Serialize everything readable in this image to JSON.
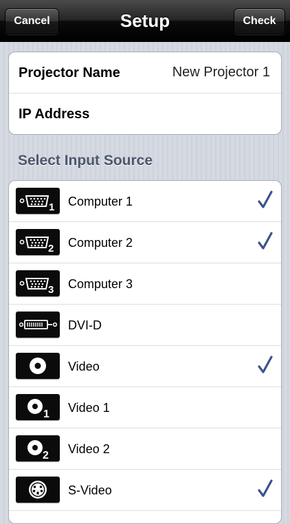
{
  "navbar": {
    "title": "Setup",
    "cancel_label": "Cancel",
    "check_label": "Check"
  },
  "info": {
    "projector_name_label": "Projector Name",
    "projector_name_value": "New Projector 1",
    "ip_address_label": "IP Address",
    "ip_address_value": ""
  },
  "section_header": "Select Input Source",
  "sources": [
    {
      "label": "Computer 1",
      "icon": "vga-1-icon",
      "checked": true
    },
    {
      "label": "Computer 2",
      "icon": "vga-2-icon",
      "checked": true
    },
    {
      "label": "Computer 3",
      "icon": "vga-3-icon",
      "checked": false
    },
    {
      "label": "DVI-D",
      "icon": "dvi-icon",
      "checked": false
    },
    {
      "label": "Video",
      "icon": "video-icon",
      "checked": true
    },
    {
      "label": "Video 1",
      "icon": "video-1-icon",
      "checked": false
    },
    {
      "label": "Video 2",
      "icon": "video-2-icon",
      "checked": false
    },
    {
      "label": "S-Video",
      "icon": "s-video-icon",
      "checked": true
    }
  ],
  "colors": {
    "checkmark": "#3a5489",
    "section_header": "#4c566c"
  }
}
